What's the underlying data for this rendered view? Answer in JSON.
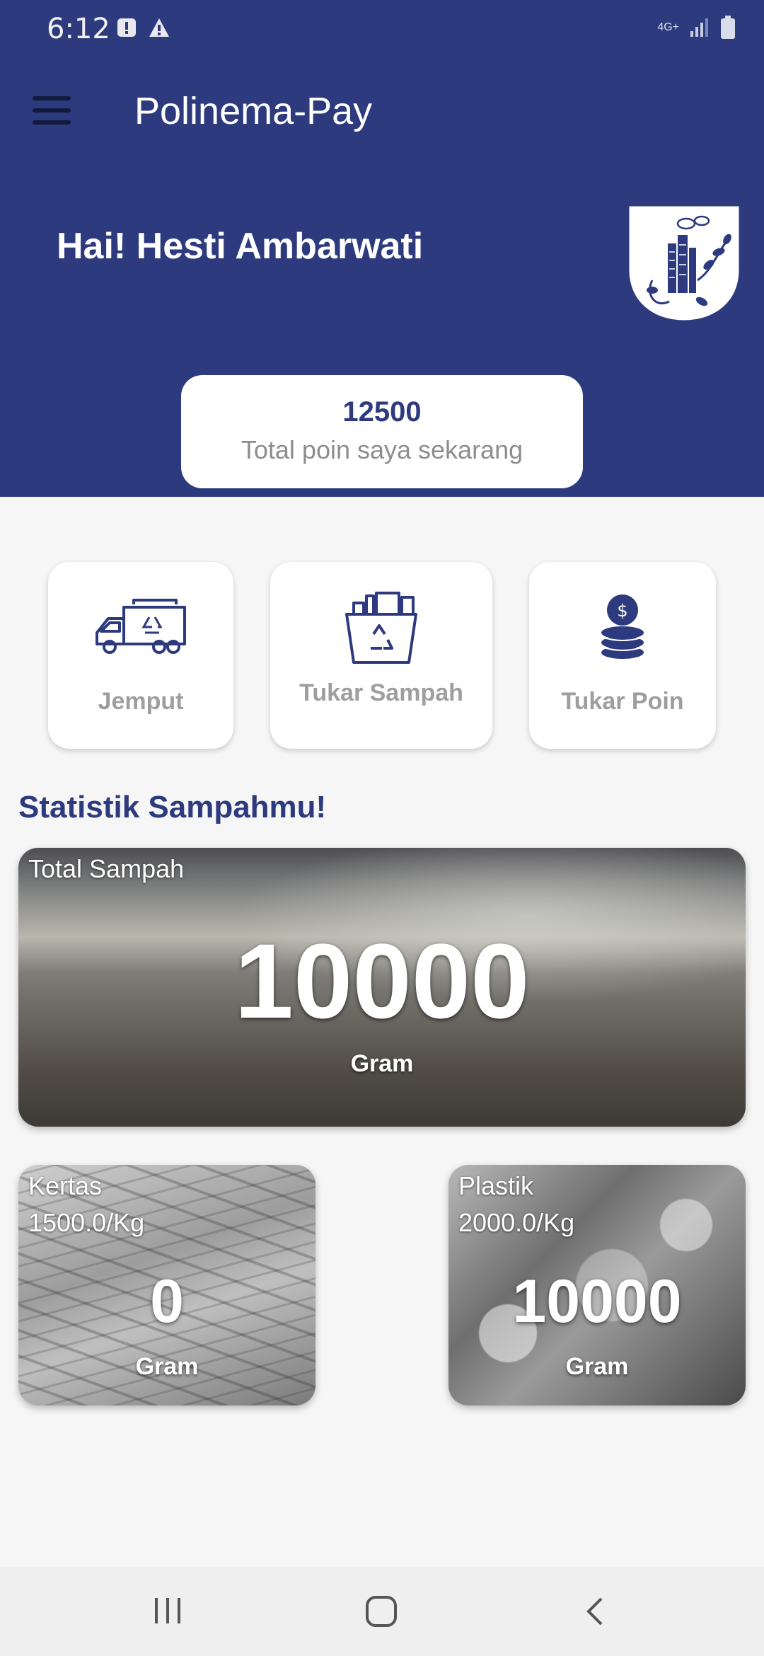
{
  "status_bar": {
    "time": "6:12",
    "network": "4G+"
  },
  "app": {
    "title": "Polinema-Pay"
  },
  "greeting": "Hai! Hesti Ambarwati",
  "points": {
    "value": "12500",
    "label": "Total poin saya sekarang"
  },
  "menu": [
    {
      "label": "Jemput",
      "icon": "garbage-truck-icon"
    },
    {
      "label": "Tukar Sampah",
      "icon": "recycle-basket-icon"
    },
    {
      "label": "Tukar Poin",
      "icon": "coin-stack-icon"
    }
  ],
  "stats": {
    "title": "Statistik Sampahmu!",
    "total": {
      "label": "Total Sampah",
      "value": "10000",
      "unit": "Gram"
    },
    "kertas": {
      "label": "Kertas",
      "rate": "1500.0/Kg",
      "value": "0",
      "unit": "Gram"
    },
    "plastik": {
      "label": "Plastik",
      "rate": "2000.0/Kg",
      "value": "10000",
      "unit": "Gram"
    }
  },
  "colors": {
    "primary": "#2d3a7e",
    "card_label": "#9e9e9e",
    "background": "#f6f6f6"
  }
}
